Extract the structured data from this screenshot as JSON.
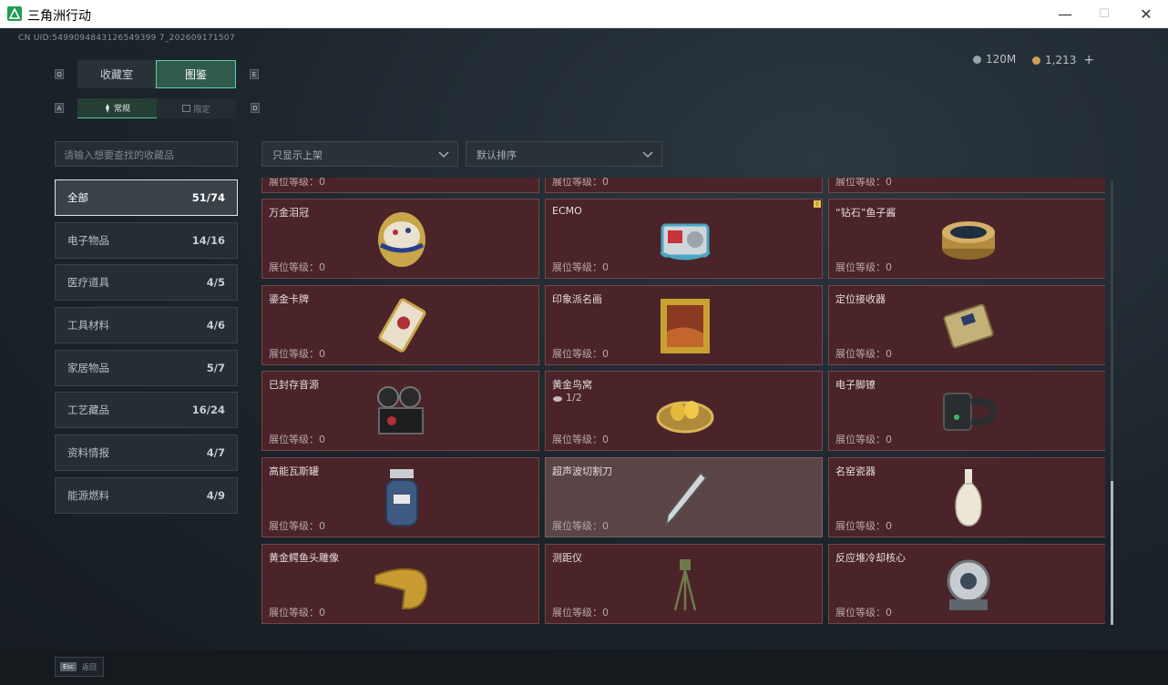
{
  "window": {
    "title": "三角洲行动",
    "minimize": "—",
    "maximize": "☐",
    "close": "✕"
  },
  "uid": "CN UID:5499094843126549399 7_202609171507",
  "currency": {
    "money": "120M",
    "coins": "1,213",
    "add": "+"
  },
  "tabs": [
    {
      "label": "收藏室",
      "active": false
    },
    {
      "label": "图鉴",
      "active": true
    }
  ],
  "tab_keys": {
    "left": "Q",
    "right": "E"
  },
  "subtabs": [
    {
      "label": "常规",
      "active": true
    },
    {
      "label": "限定",
      "active": false
    }
  ],
  "subtab_keys": {
    "left": "A",
    "right": "D"
  },
  "search": {
    "placeholder": "请输入想要查找的收藏品"
  },
  "categories": [
    {
      "label": "全部",
      "count": "51/74",
      "active": true
    },
    {
      "label": "电子物品",
      "count": "14/16"
    },
    {
      "label": "医疗道具",
      "count": "4/5"
    },
    {
      "label": "工具材料",
      "count": "4/6"
    },
    {
      "label": "家居物品",
      "count": "5/7"
    },
    {
      "label": "工艺藏品",
      "count": "16/24"
    },
    {
      "label": "资料情报",
      "count": "4/7"
    },
    {
      "label": "能源燃料",
      "count": "4/9"
    }
  ],
  "filters": {
    "shelf": "只显示上架",
    "sort": "默认排序"
  },
  "partial_level": "展位等级：0",
  "items": [
    {
      "name": "万金泪冠",
      "level": "展位等级：0",
      "icon": "egg-icon"
    },
    {
      "name": "ECMO",
      "level": "展位等级：0",
      "icon": "ecmo-icon",
      "badge": "!"
    },
    {
      "name": "“钻石”鱼子酱",
      "level": "展位等级：0",
      "icon": "caviar-icon"
    },
    {
      "name": "鎏金卡牌",
      "level": "展位等级：0",
      "icon": "card-icon"
    },
    {
      "name": "印象派名画",
      "level": "展位等级：0",
      "icon": "painting-icon"
    },
    {
      "name": "定位接收器",
      "level": "展位等级：0",
      "icon": "receiver-icon"
    },
    {
      "name": "已封存音源",
      "level": "展位等级：0",
      "icon": "projector-icon"
    },
    {
      "name": "黄金鸟窝",
      "level": "展位等级：0",
      "icon": "nest-icon",
      "sub": "1/2"
    },
    {
      "name": "电子脚镣",
      "level": "展位等级：0",
      "icon": "anklet-icon"
    },
    {
      "name": "高能瓦斯罐",
      "level": "展位等级：0",
      "icon": "gas-tank-icon"
    },
    {
      "name": "超声波切割刀",
      "level": "展位等级：0",
      "icon": "knife-icon",
      "dim": true
    },
    {
      "name": "名窑瓷器",
      "level": "展位等级：0",
      "icon": "vase-icon"
    },
    {
      "name": "黄金鳄鱼头雕像",
      "level": "展位等级：0",
      "icon": "croc-icon"
    },
    {
      "name": "测距仪",
      "level": "展位等级：0",
      "icon": "rangefinder-icon"
    },
    {
      "name": "反应堆冷却核心",
      "level": "展位等级：0",
      "icon": "reactor-icon"
    }
  ],
  "footer": {
    "key": "Esc",
    "label": "返回"
  },
  "colors": {
    "accent": "#5fd1a0",
    "card_bg": "#4a2428",
    "card_border": "#72464a"
  }
}
